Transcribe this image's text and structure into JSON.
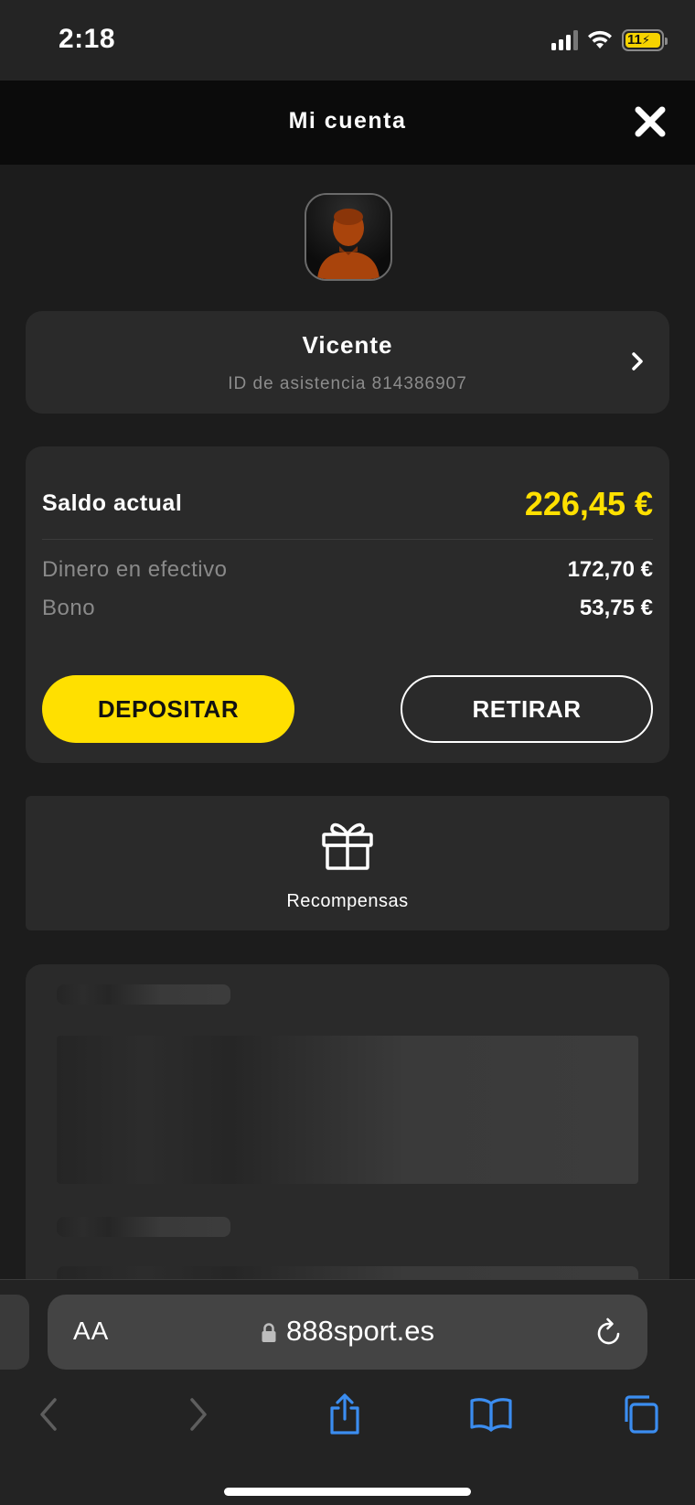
{
  "status_bar": {
    "time": "2:18",
    "battery": "11"
  },
  "header": {
    "title": "Mi cuenta",
    "close_icon": "close-icon"
  },
  "user": {
    "name": "Vicente",
    "support_id": "ID de asistencia 814386907"
  },
  "balance": {
    "label": "Saldo actual",
    "value": "226,45 €",
    "rows": [
      {
        "label": "Dinero en efectivo",
        "value": "172,70 €"
      },
      {
        "label": "Bono",
        "value": "53,75 €"
      }
    ],
    "deposit_label": "DEPOSITAR",
    "withdraw_label": "RETIRAR"
  },
  "rewards": {
    "label": "Recompensas",
    "icon": "gift-icon"
  },
  "browser": {
    "aa_label": "AA",
    "url": "888sport.es"
  },
  "colors": {
    "accent": "#ffe000",
    "background": "#1c1c1c",
    "card": "#2a2a2a",
    "safari_blue": "#3b8df0"
  }
}
